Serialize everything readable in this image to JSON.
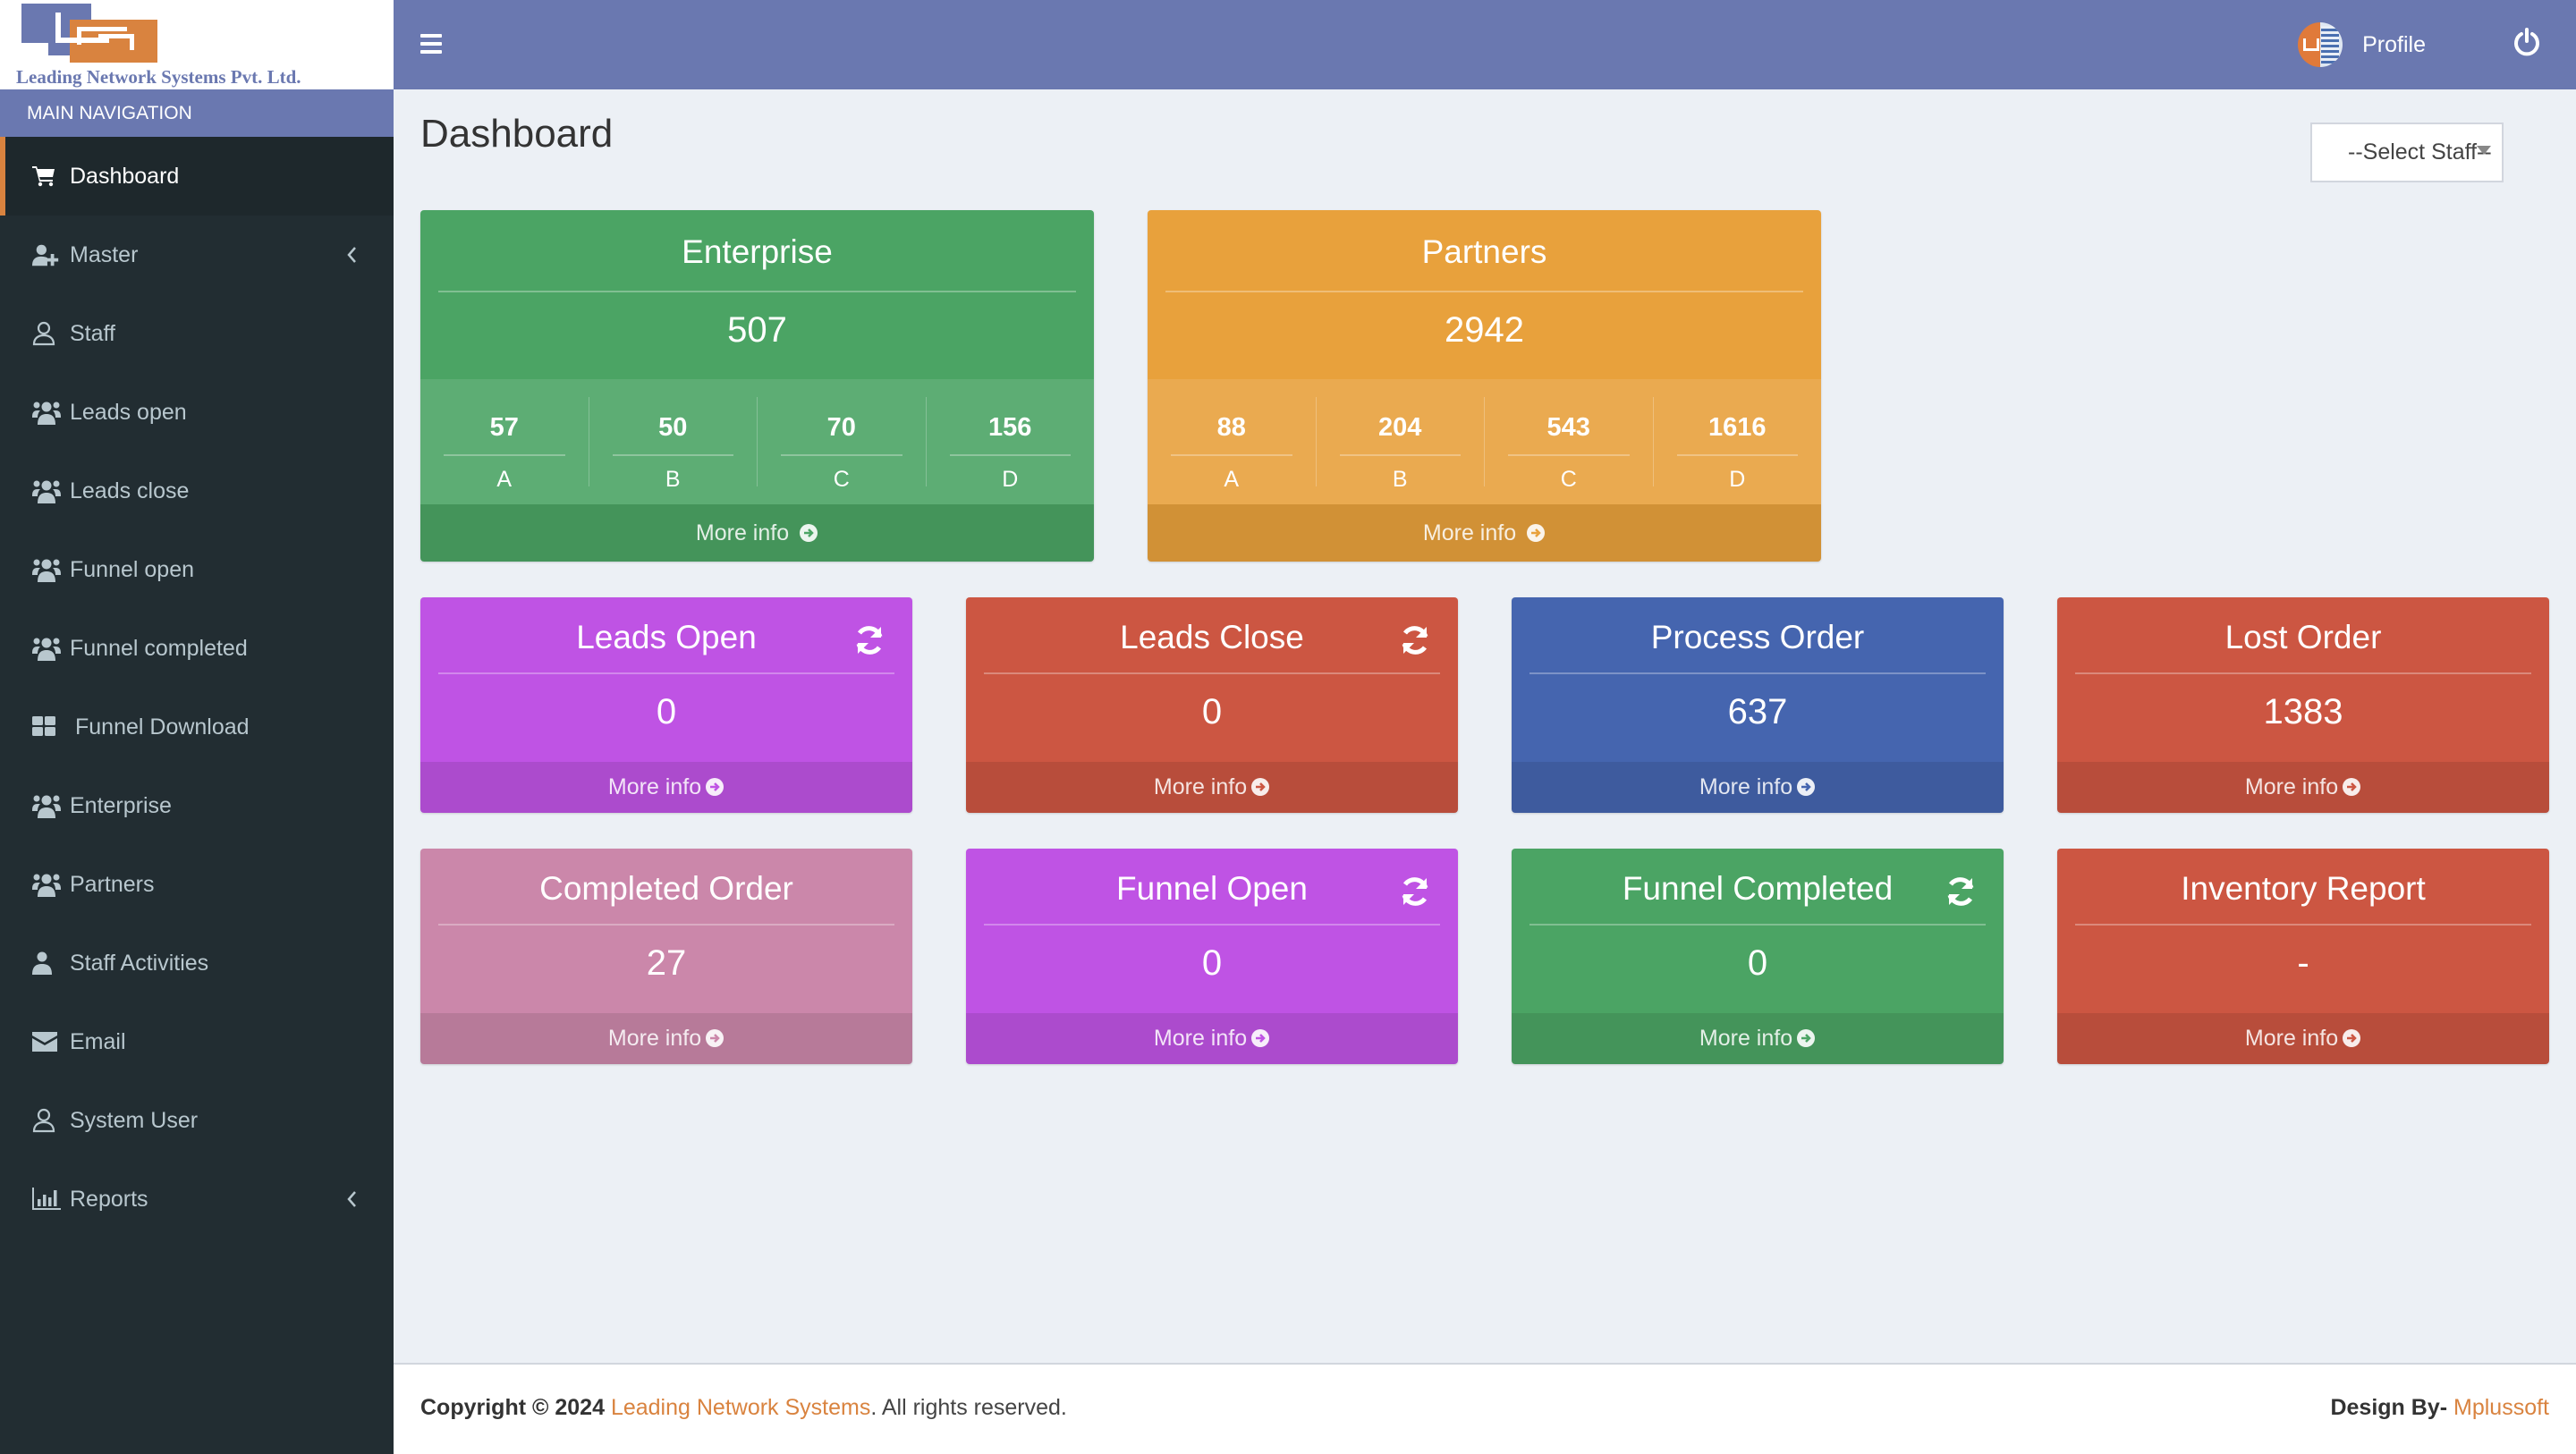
{
  "brand": {
    "company_name": "Leading Network Systems Pvt. Ltd.",
    "colors": {
      "sidebar": "#222d32",
      "header": "#6a78b0",
      "accent": "#d9833f"
    }
  },
  "sidebar": {
    "section_label": "MAIN NAVIGATION",
    "items": [
      {
        "label": "Dashboard",
        "icon": "shopping-cart-icon",
        "active": true
      },
      {
        "label": "Master",
        "icon": "user-plus-icon",
        "has_submenu": true
      },
      {
        "label": "Staff",
        "icon": "user-outline-icon"
      },
      {
        "label": "Leads open",
        "icon": "users-icon"
      },
      {
        "label": "Leads close",
        "icon": "users-icon"
      },
      {
        "label": "Funnel open",
        "icon": "users-icon"
      },
      {
        "label": "Funnel completed",
        "icon": "users-icon"
      },
      {
        "label": "Funnel Download",
        "icon": "grid-icon"
      },
      {
        "label": "Enterprise",
        "icon": "users-icon"
      },
      {
        "label": "Partners",
        "icon": "users-icon"
      },
      {
        "label": "Staff Activities",
        "icon": "user-icon"
      },
      {
        "label": "Email",
        "icon": "envelope-icon"
      },
      {
        "label": "System User",
        "icon": "user-outline-icon"
      },
      {
        "label": "Reports",
        "icon": "bar-chart-icon",
        "has_submenu": true
      }
    ]
  },
  "header": {
    "menu_toggle_icon": "hamburger-icon",
    "profile_label": "Profile",
    "logout_icon": "power-icon"
  },
  "main": {
    "page_title": "Dashboard",
    "staff_select": {
      "selected": "--Select Staff--"
    },
    "more_info_label": "More info",
    "summary_boxes": [
      {
        "title": "Enterprise",
        "value": "507",
        "color": "#4ba464",
        "breakdown": [
          {
            "value": "57",
            "label": "A"
          },
          {
            "value": "50",
            "label": "B"
          },
          {
            "value": "70",
            "label": "C"
          },
          {
            "value": "156",
            "label": "D"
          }
        ]
      },
      {
        "title": "Partners",
        "value": "2942",
        "color": "#e8a13c",
        "breakdown": [
          {
            "value": "88",
            "label": "A"
          },
          {
            "value": "204",
            "label": "B"
          },
          {
            "value": "543",
            "label": "C"
          },
          {
            "value": "1616",
            "label": "D"
          }
        ]
      }
    ],
    "stat_boxes": [
      {
        "title": "Leads Open",
        "value": "0",
        "color": "#bf53e4",
        "refresh": true
      },
      {
        "title": "Leads Close",
        "value": "0",
        "color": "#cc5642",
        "refresh": true
      },
      {
        "title": "Process Order",
        "value": "637",
        "color": "#4565af",
        "refresh": false
      },
      {
        "title": "Lost Order",
        "value": "1383",
        "color": "#cc5642",
        "refresh": false
      },
      {
        "title": "Completed Order",
        "value": "27",
        "color": "#cb87aa",
        "refresh": false
      },
      {
        "title": "Funnel Open",
        "value": "0",
        "color": "#bf53e4",
        "refresh": true
      },
      {
        "title": "Funnel Completed",
        "value": "0",
        "color": "#4ba464",
        "refresh": true
      },
      {
        "title": "Inventory Report",
        "value": "-",
        "color": "#cc5642",
        "refresh": false
      }
    ]
  },
  "footer": {
    "copyright_prefix": "Copyright © 2024",
    "company_link": "Leading Network Systems",
    "rights": ". All rights reserved.",
    "design_by_label": "Design By-",
    "designer_link": "Mplussoft"
  }
}
